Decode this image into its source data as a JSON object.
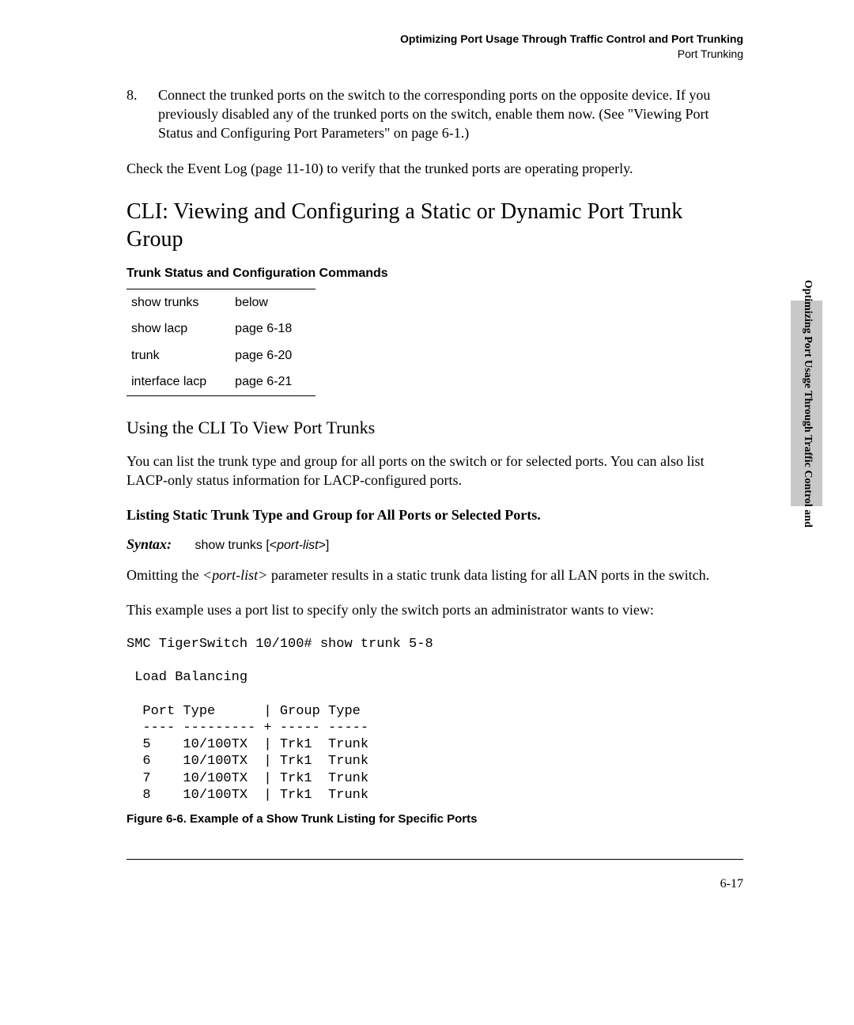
{
  "header": {
    "line1": "Optimizing Port Usage Through Traffic Control and Port Trunking",
    "line2": "Port Trunking"
  },
  "step": {
    "num": "8.",
    "text": "Connect the trunked ports on the switch to the corresponding ports on the opposite device. If you previously disabled any of the trunked ports on the switch, enable them now. (See \"Viewing Port Status and Configuring Port Parameters\" on page 6-1.)"
  },
  "para1": "Check the Event Log (page 11-10) to verify that the trunked ports are operating properly.",
  "h2": "CLI: Viewing and Configuring a Static or Dynamic Port Trunk Group",
  "table_title": "Trunk Status and Configuration Commands",
  "cmd_table": [
    {
      "cmd": "show trunks",
      "ref": "below"
    },
    {
      "cmd": "show lacp",
      "ref": "page 6-18"
    },
    {
      "cmd": "trunk",
      "ref": "page 6-20"
    },
    {
      "cmd": "interface lacp",
      "ref": "page 6-21"
    }
  ],
  "h3": "Using the CLI To View Port Trunks",
  "para2": "You can list the trunk type and group for all ports on the switch or for selected ports. You can also list LACP-only status information for LACP-configured ports.",
  "bold1": "Listing Static Trunk Type and Group for All Ports or Selected Ports.",
  "syntax": {
    "label": "Syntax:",
    "cmd_plain": "show trunks [<",
    "cmd_ital": "port-list",
    "cmd_end": ">]"
  },
  "para3a": "Omitting the ",
  "para3_ital": "<port-list>",
  "para3b": " parameter results in a static trunk data listing for all LAN ports in the switch.",
  "para4": "This example uses a port list to specify only the switch ports an administrator wants to view:",
  "cli": "SMC TigerSwitch 10/100# show trunk 5-8\n\n Load Balancing\n\n  Port Type      | Group Type\n  ---- --------- + ----- -----\n  5    10/100TX  | Trk1  Trunk\n  6    10/100TX  | Trk1  Trunk\n  7    10/100TX  | Trk1  Trunk\n  8    10/100TX  | Trk1  Trunk",
  "figcap": "Figure 6-6.  Example of a Show Trunk Listing for Specific Ports",
  "pagenum": "6-17",
  "sidetab": "Optimizing Port Usage\nThrough Traffic Control and"
}
